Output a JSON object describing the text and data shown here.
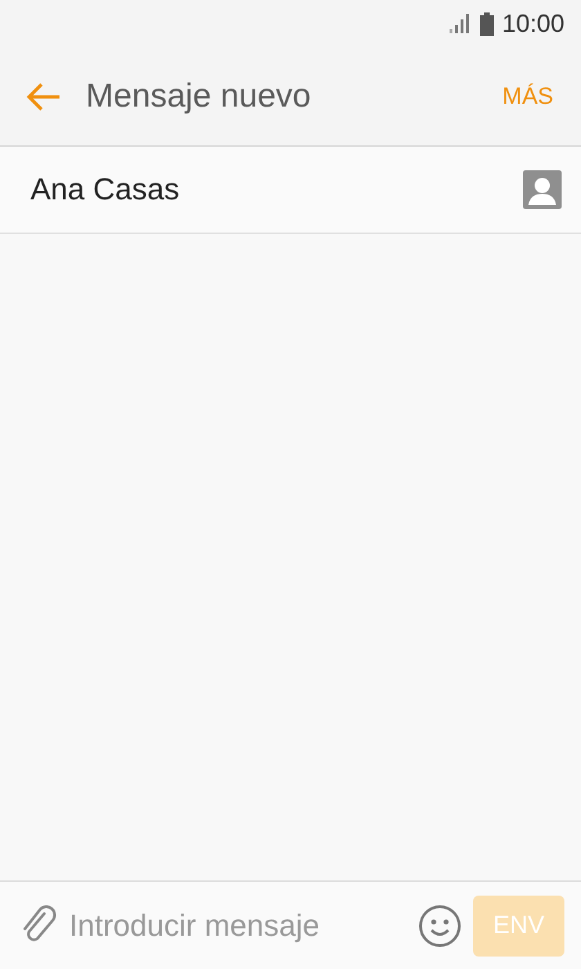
{
  "status_bar": {
    "time": "10:00"
  },
  "header": {
    "title": "Mensaje nuevo",
    "action": "MÁS"
  },
  "recipient": {
    "value": "Ana Casas"
  },
  "composer": {
    "placeholder": "Introducir mensaje",
    "send": {
      "label": "ENV",
      "disabled": true
    }
  }
}
